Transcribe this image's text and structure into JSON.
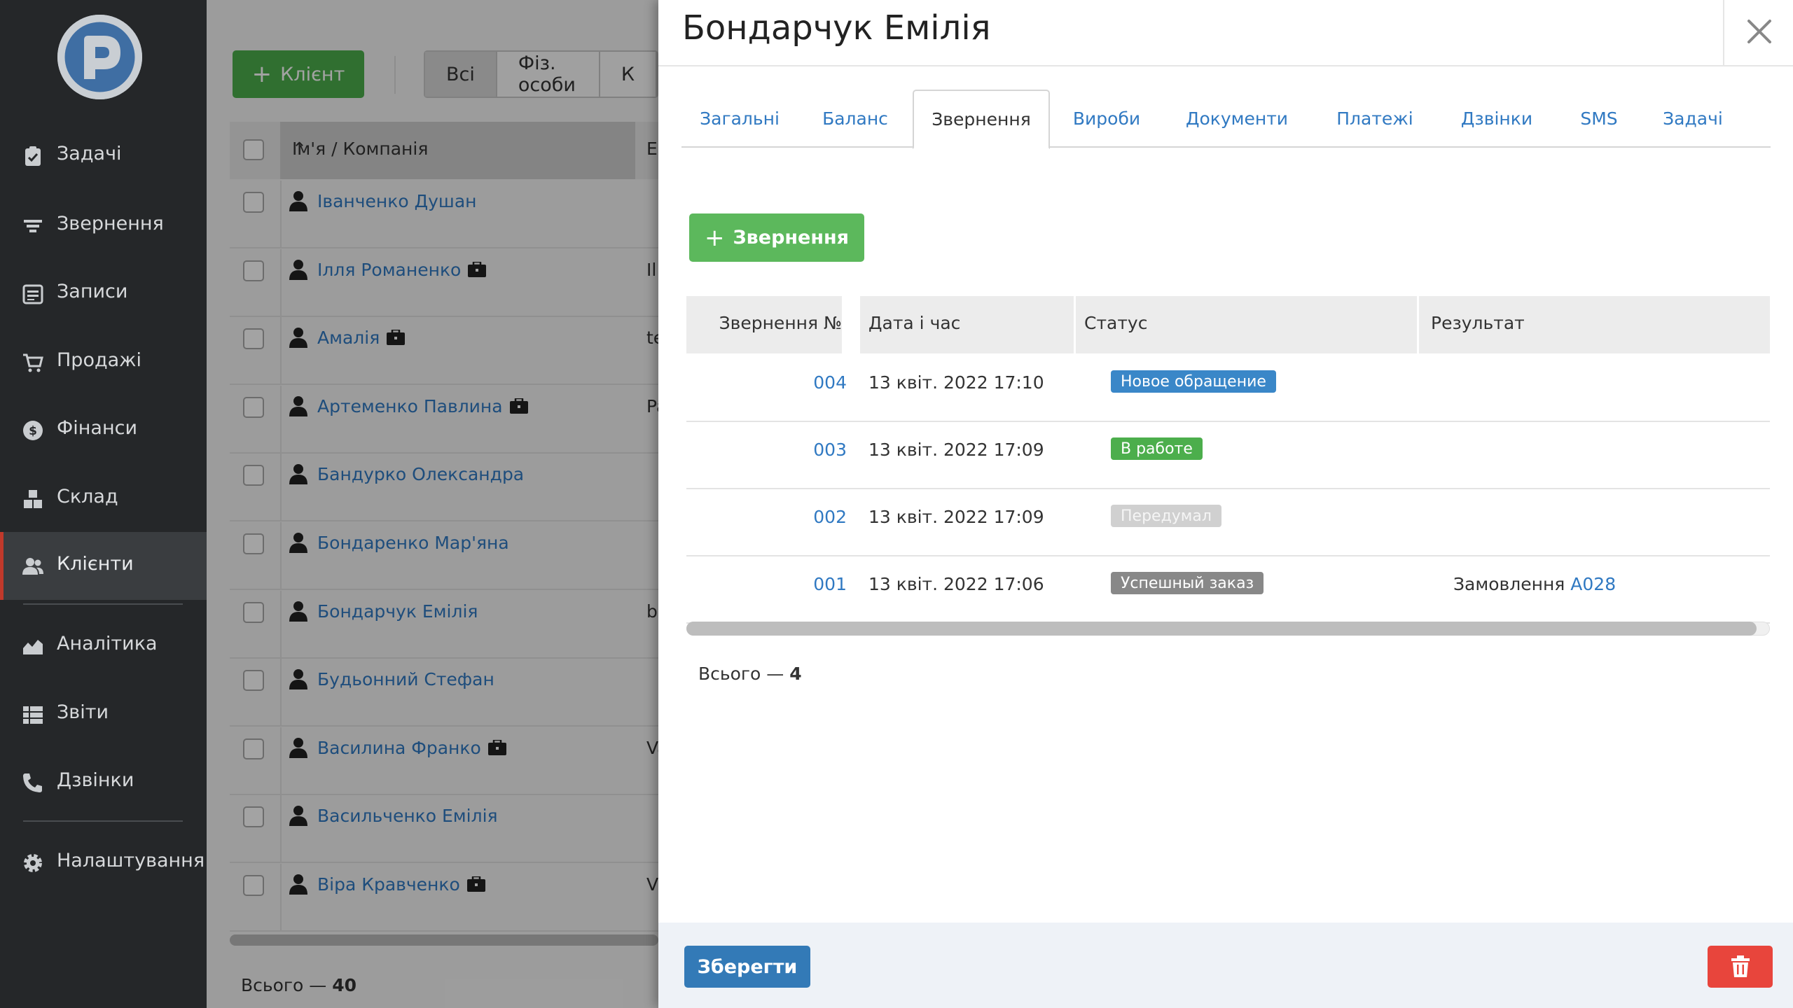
{
  "sidebar": {
    "logo_icon": "crm-logo-icon",
    "items": [
      {
        "label": "Задачі",
        "icon": "clipboard-icon"
      },
      {
        "label": "Звернення",
        "icon": "filter-icon"
      },
      {
        "label": "Записи",
        "icon": "calendar-list-icon"
      },
      {
        "label": "Продажі",
        "icon": "cart-icon"
      },
      {
        "label": "Фінанси",
        "icon": "dollar-icon"
      },
      {
        "label": "Склад",
        "icon": "boxes-icon"
      },
      {
        "label": "Клієнти",
        "icon": "users-icon",
        "active": true
      },
      {
        "label": "Аналітика",
        "icon": "chart-area-icon"
      },
      {
        "label": "Звіти",
        "icon": "list-icon"
      },
      {
        "label": "Дзвінки",
        "icon": "phone-icon"
      },
      {
        "label": "Налаштування",
        "icon": "gear-icon"
      }
    ]
  },
  "client_list": {
    "add_button": "Клієнт",
    "filters": [
      "Всі",
      "Фіз. особи",
      "К"
    ],
    "active_filter": "Всі",
    "columns": {
      "name": "Ім'я / Компанія",
      "email": "E"
    },
    "rows": [
      {
        "name": "Іванченко Душан",
        "company": false,
        "email": ""
      },
      {
        "name": "Ілля Романенко",
        "company": true,
        "email": "Il"
      },
      {
        "name": "Амалія",
        "company": true,
        "email": "te"
      },
      {
        "name": "Артеменко Павлина",
        "company": true,
        "email": "Pa"
      },
      {
        "name": "Бандурко Олександра",
        "company": false,
        "email": ""
      },
      {
        "name": "Бондаренко Мар'яна",
        "company": false,
        "email": ""
      },
      {
        "name": "Бондарчук Емілія",
        "company": false,
        "email": "bo"
      },
      {
        "name": "Будьонний Стефан",
        "company": false,
        "email": ""
      },
      {
        "name": "Василина Франко",
        "company": true,
        "email": "Va"
      },
      {
        "name": "Васильченко Емілія",
        "company": false,
        "email": ""
      },
      {
        "name": "Віра Кравченко",
        "company": true,
        "email": "Vi"
      }
    ],
    "total_label": "Всього —",
    "total_value": "40"
  },
  "panel": {
    "title": "Бондарчук Емілія",
    "tabs": [
      "Загальні",
      "Баланс",
      "Звернення",
      "Вироби",
      "Документи",
      "Платежі",
      "Дзвінки",
      "SMS",
      "Задачі"
    ],
    "active_tab": "Звернення",
    "add_button": "Звернення",
    "table": {
      "headers": {
        "number": "Звернення №",
        "date": "Дата і час",
        "status": "Статус",
        "result": "Результат"
      },
      "rows": [
        {
          "number": "004",
          "date": "13 квіт. 2022 17:10",
          "status": "Новое обращение",
          "status_color": "#3a87c8",
          "result_text": "",
          "result_link": ""
        },
        {
          "number": "003",
          "date": "13 квіт. 2022 17:09",
          "status": "В работе",
          "status_color": "#4cae4c",
          "result_text": "",
          "result_link": ""
        },
        {
          "number": "002",
          "date": "13 квіт. 2022 17:09",
          "status": "Передумал",
          "status_color": "#d0d0d0",
          "result_text": "",
          "result_link": ""
        },
        {
          "number": "001",
          "date": "13 квіт. 2022 17:06",
          "status": "Успешный заказ",
          "status_color": "#888888",
          "result_text": "Замовлення",
          "result_link": "A028"
        }
      ]
    },
    "total_label": "Всього —",
    "total_value": "4",
    "save_button": "Зберегти",
    "delete_icon": "trash-icon",
    "close_icon": "close-icon"
  },
  "colors": {
    "sidebar_bg": "#252729",
    "accent_green": "#5cb85c",
    "primary_blue": "#337ab7",
    "danger_red": "#e8453c",
    "link_blue": "#3079c2"
  }
}
